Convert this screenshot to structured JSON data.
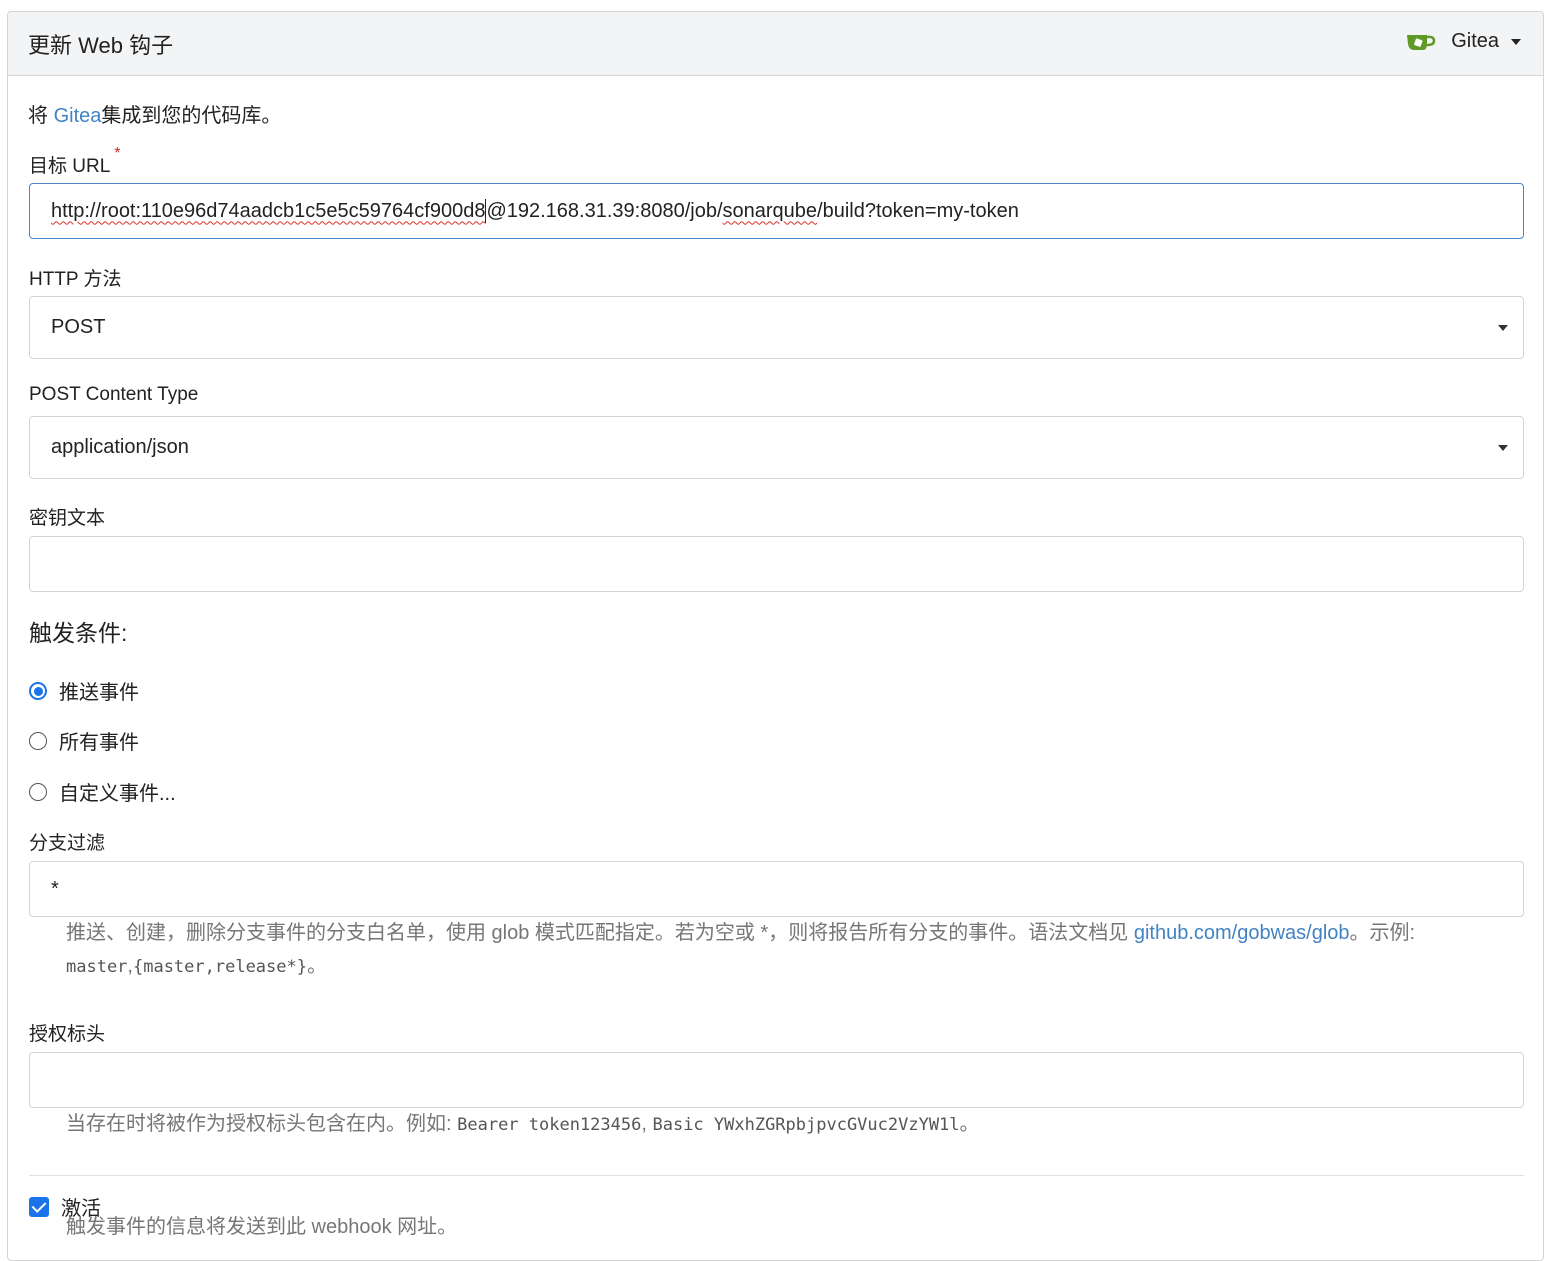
{
  "header": {
    "title": "更新 Web 钩子",
    "type_label": "Gitea",
    "icon": "gitea-logo-icon"
  },
  "intro": {
    "prefix": "将 ",
    "link": "Gitea",
    "suffix": "集成到您的代码库。"
  },
  "target_url": {
    "label": "目标 URL",
    "required_mark": "*",
    "value_part1": "http://root:110e96d74aadcb1c5e5c59764cf900d8",
    "value_part2": "@192.168.31.39:8080/job/",
    "value_part3": "sonarqube",
    "value_part4": "/build?token=my-token"
  },
  "http_method": {
    "label": "HTTP 方法",
    "selected": "POST"
  },
  "content_type": {
    "label": "POST Content Type",
    "selected": "application/json"
  },
  "secret": {
    "label": "密钥文本",
    "value": ""
  },
  "triggers": {
    "title": "触发条件:",
    "options": [
      {
        "label": "推送事件",
        "checked": true
      },
      {
        "label": "所有事件",
        "checked": false
      },
      {
        "label": "自定义事件...",
        "checked": false
      }
    ]
  },
  "branch_filter": {
    "label": "分支过滤",
    "value": "*",
    "help_line1_prefix": "推送、创建，删除分支事件的分支白名单，使用 glob 模式匹配指定。若为空或 *，则将报告所有分支的事件。语法文档见 ",
    "help_link": "github.com/gobwas/glob",
    "help_line1_suffix": "。示例:",
    "help_example1": "master",
    "help_example_sep": ",",
    "help_example2": "{master,release*}",
    "help_end": "。"
  },
  "auth_header": {
    "label": "授权标头",
    "value": "",
    "help_prefix": "当存在时将被作为授权标头包含在内。例如: ",
    "help_example1": "Bearer token123456",
    "help_sep": ", ",
    "help_example2": "Basic YWxhZGRpbjpvcGVuc2VzYW1l",
    "help_end": "。"
  },
  "active": {
    "label": "激活",
    "checked": true,
    "help": "触发事件的信息将发送到此 webhook 网址。"
  },
  "colors": {
    "accent": "#1a73e8",
    "link": "#4183c4",
    "required": "#db2828",
    "header_bg": "#f3f4f5",
    "gitea_green": "#609926"
  }
}
